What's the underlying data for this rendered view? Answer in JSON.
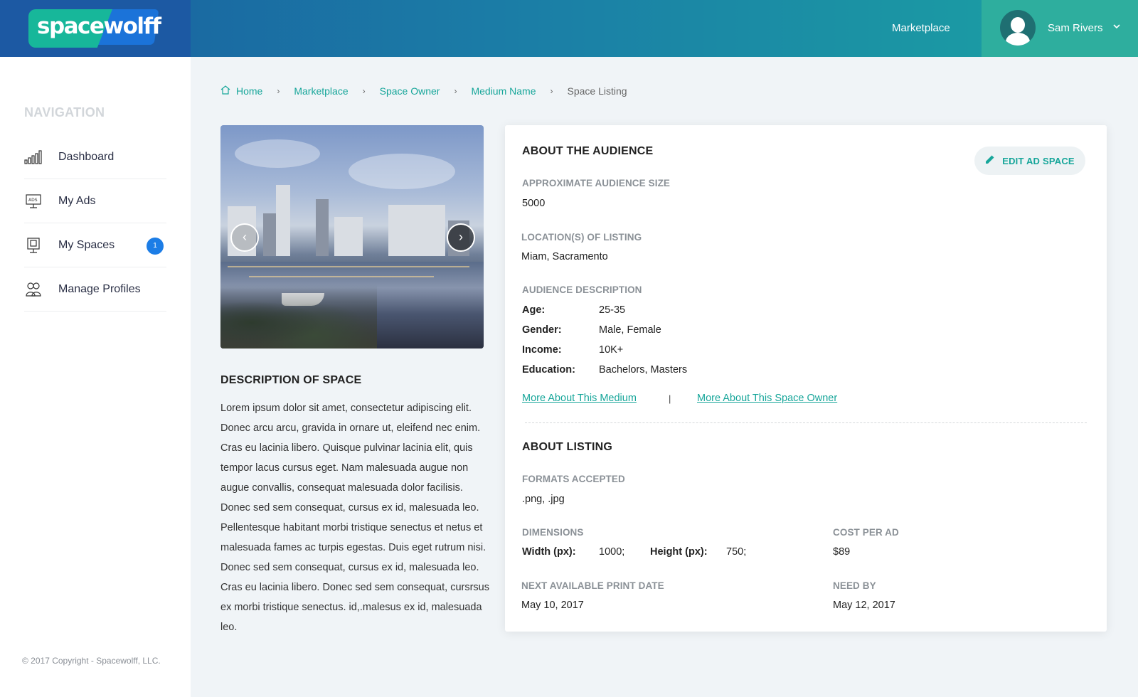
{
  "brand": {
    "logo_text": "spacewolff"
  },
  "header": {
    "marketplace_label": "Marketplace",
    "user_name": "Sam Rivers"
  },
  "sidebar": {
    "nav_title": "NAVIGATION",
    "items": [
      {
        "label": "Dashboard",
        "icon": "bar-chart-icon"
      },
      {
        "label": "My Ads",
        "icon": "ads-icon"
      },
      {
        "label": "My Spaces",
        "icon": "billboard-icon",
        "badge": "1"
      },
      {
        "label": "Manage Profiles",
        "icon": "profiles-icon"
      }
    ],
    "copyright": "© 2017 Copyright - Spacewolff, LLC."
  },
  "breadcrumb": {
    "items": [
      "Home",
      "Marketplace",
      "Space Owner",
      "Medium Name"
    ],
    "current": "Space Listing"
  },
  "description": {
    "title": "DESCRIPTION OF SPACE",
    "text": "Lorem ipsum dolor sit amet, consectetur adipiscing elit. Donec arcu arcu, gravida in ornare ut, eleifend nec enim. Cras eu lacinia libero. Quisque pulvinar lacinia elit, quis tempor lacus cursus eget. Nam malesuada augue non augue convallis, consequat malesuada dolor facilisis. Donec sed sem consequat, cursus ex id, malesuada leo. Pellentesque habitant morbi tristique senectus et netus et malesuada fames ac turpis egestas. Duis eget rutrum nisi. Donec sed sem consequat, cursus ex id, malesuada leo. Cras eu lacinia libero. Donec sed sem consequat, cursrsus ex morbi tristique senectus. id,.malesus ex id, malesuada leo."
  },
  "carousel": {
    "prev": "‹",
    "next": "›"
  },
  "audience": {
    "title": "ABOUT THE AUDIENCE",
    "edit_button": "EDIT AD SPACE",
    "size_label": "APPROXIMATE AUDIENCE SIZE",
    "size_value": "5000",
    "location_label": "LOCATION(S) OF LISTING",
    "location_value": "Miam, Sacramento",
    "desc_label": "AUDIENCE DESCRIPTION",
    "age_key": "Age:",
    "age_val": "25-35",
    "gender_key": "Gender:",
    "gender_val": "Male, Female",
    "income_key": "Income:",
    "income_val": "10K+",
    "education_key": "Education:",
    "education_val": "Bachelors, Masters",
    "link_medium": "More About This Medium",
    "separator": "|",
    "link_owner": "More About This Space Owner"
  },
  "listing": {
    "title": "ABOUT LISTING",
    "formats_label": "FORMATS ACCEPTED",
    "formats_value": ".png, .jpg",
    "dimensions_label": "DIMENSIONS",
    "width_key": "Width (px):",
    "width_val": "1000;",
    "height_key": "Height (px):",
    "height_val": "750;",
    "cost_label": "COST PER AD",
    "cost_value": "$89",
    "print_date_label": "NEXT AVAILABLE PRINT DATE",
    "print_date_value": "May 10, 2017",
    "need_by_label": "NEED BY",
    "need_by_value": "May 12, 2017"
  },
  "colors": {
    "accent": "#17a69a",
    "badge": "#1c7de6",
    "header_start": "#1a5fa0",
    "header_end": "#1ba3a3"
  }
}
